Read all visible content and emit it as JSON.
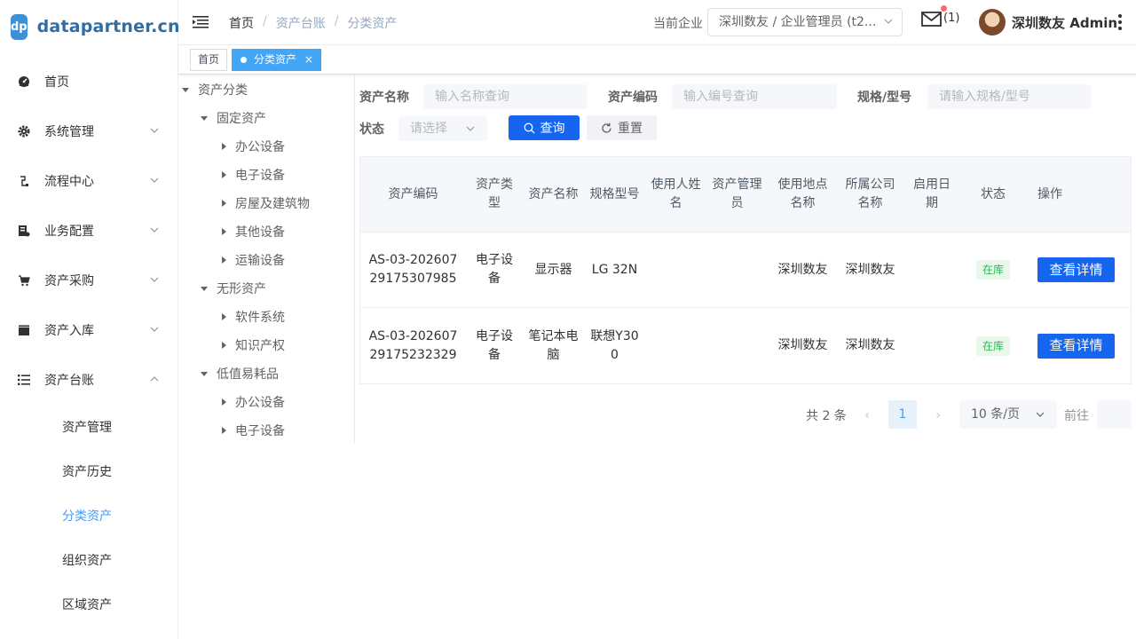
{
  "logo": {
    "badge": "dp",
    "text": "datapartner.cn"
  },
  "sidebar": {
    "items": [
      {
        "label": "首页",
        "icon": "dashboard-icon"
      },
      {
        "label": "系统管理",
        "icon": "gear-icon"
      },
      {
        "label": "流程中心",
        "icon": "flow-icon"
      },
      {
        "label": "业务配置",
        "icon": "config-icon"
      },
      {
        "label": "资产采购",
        "icon": "cart-icon"
      },
      {
        "label": "资产入库",
        "icon": "clapper-icon"
      },
      {
        "label": "资产台账",
        "icon": "list-icon"
      }
    ],
    "sub_items": [
      {
        "label": "资产管理"
      },
      {
        "label": "资产历史"
      },
      {
        "label": "分类资产",
        "active": true
      },
      {
        "label": "组织资产"
      },
      {
        "label": "区域资产"
      }
    ]
  },
  "header": {
    "breadcrumb": [
      "首页",
      "资产台账",
      "分类资产"
    ],
    "company_label": "当前企业",
    "company_value": "深圳数友 / 企业管理员 (t2...",
    "mail_count": "(1)",
    "user_name": "深圳数友 Admin"
  },
  "tags": [
    {
      "label": "首页"
    },
    {
      "label": "分类资产",
      "close": "×",
      "active": true
    }
  ],
  "tree": {
    "root": "资产分类",
    "groups": [
      {
        "label": "固定资产",
        "children": [
          "办公设备",
          "电子设备",
          "房屋及建筑物",
          "其他设备",
          "运输设备"
        ]
      },
      {
        "label": "无形资产",
        "children": [
          "软件系统",
          "知识产权"
        ]
      },
      {
        "label": "低值易耗品",
        "children": [
          "办公设备",
          "电子设备"
        ]
      }
    ]
  },
  "filters": {
    "name_label": "资产名称",
    "name_placeholder": "输入名称查询",
    "code_label": "资产编码",
    "code_placeholder": "输入编号查询",
    "spec_label": "规格/型号",
    "spec_placeholder": "请输入规格/型号",
    "status_label": "状态",
    "status_placeholder": "请选择",
    "search_button": "查询",
    "reset_button": "重置"
  },
  "table": {
    "headers": [
      "资产编码",
      "资产类型",
      "资产名称",
      "规格型号",
      "使用人姓名",
      "资产管理员",
      "使用地点名称",
      "所属公司名称",
      "启用日期",
      "状态",
      "操作"
    ],
    "rows": [
      {
        "code": "AS-03-20260729175307985",
        "type": "电子设备",
        "name": "显示器",
        "spec": "LG 32N",
        "user": "",
        "admin": "",
        "location": "深圳数友",
        "company": "深圳数友",
        "date": "",
        "status": "在库",
        "action": "查看详情"
      },
      {
        "code": "AS-03-20260729175232329",
        "type": "电子设备",
        "name": "笔记本电脑",
        "spec": "联想Y300",
        "user": "",
        "admin": "",
        "location": "深圳数友",
        "company": "深圳数友",
        "date": "",
        "status": "在库",
        "action": "查看详情"
      }
    ]
  },
  "pagination": {
    "total": "共 2 条",
    "prev": "‹",
    "current": "1",
    "next": "›",
    "page_size": "10 条/页",
    "goto": "前往"
  },
  "colors": {
    "primary": "#1565ef",
    "active_menu": "#409eff",
    "tag_active": "#42a5f5",
    "status_green": "#30b45b",
    "logo": "#3d8fd6"
  }
}
